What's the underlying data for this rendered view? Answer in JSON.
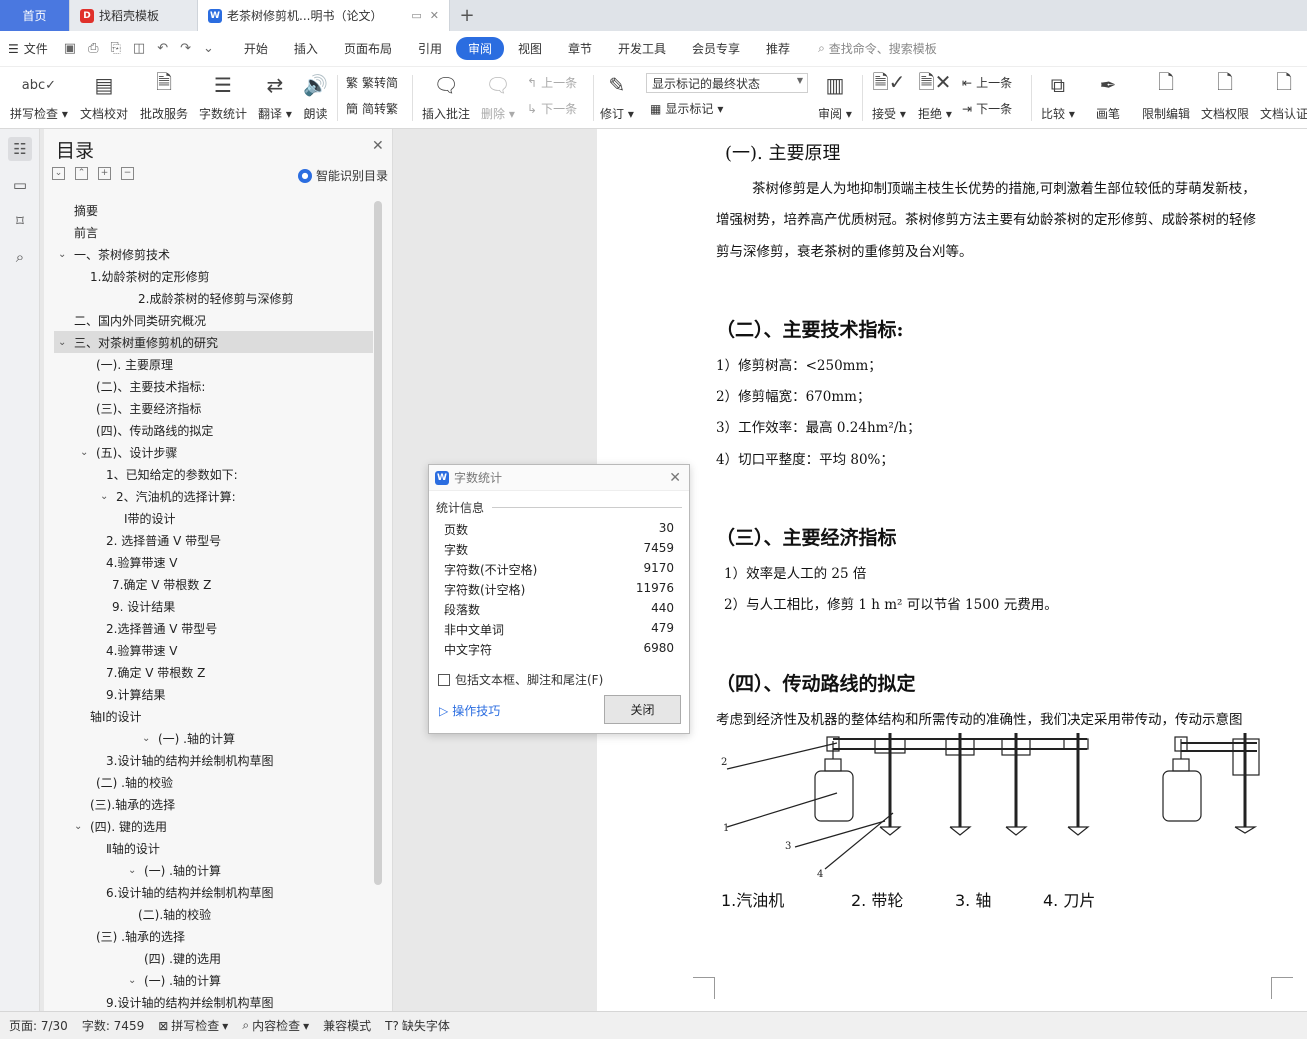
{
  "tabs": [
    {
      "label": "首页"
    },
    {
      "label": "找稻壳模板"
    },
    {
      "label": "老茶树修剪机...明书（论文）"
    }
  ],
  "menu": {
    "file": "文件",
    "items": [
      "开始",
      "插入",
      "页面布局",
      "引用",
      "审阅",
      "视图",
      "章节",
      "开发工具",
      "会员专享",
      "推荐"
    ],
    "active": "审阅",
    "search": "查找命令、搜索模板"
  },
  "ribbon": {
    "spell_check": "拼写检查",
    "doc_proof": "文档校对",
    "proof_service": "批改服务",
    "word_count": "字数统计",
    "translate": "翻译",
    "read_aloud": "朗读",
    "trad_to_simp": "繁转简",
    "simp_to_trad": "简转繁",
    "insert_comment": "插入批注",
    "delete": "删除",
    "prev": "上一条",
    "next": "下一条",
    "revise": "修订",
    "markup_state": "显示标记的最终状态",
    "show_markup": "显示标记",
    "review": "审阅",
    "accept": "接受",
    "reject": "拒绝",
    "prev2": "上一条",
    "next2": "下一条",
    "compare": "比较",
    "pen": "画笔",
    "restrict_edit": "限制编辑",
    "doc_permission": "文档权限",
    "doc_cert": "文档认证"
  },
  "toc": {
    "title": "目录",
    "smart": "智能识别目录",
    "items": [
      {
        "text": "摘要",
        "indent": 20,
        "toggle": ""
      },
      {
        "text": "前言",
        "indent": 20,
        "toggle": ""
      },
      {
        "text": "一、茶树修剪技术",
        "indent": 20,
        "toggle": "v"
      },
      {
        "text": "1.幼龄茶树的定形修剪",
        "indent": 36,
        "toggle": ""
      },
      {
        "text": "2.成龄茶树的轻修剪与深修剪",
        "indent": 84,
        "toggle": ""
      },
      {
        "text": "二、国内外同类研究概况",
        "indent": 20,
        "toggle": ""
      },
      {
        "text": "三、对茶树重修剪机的研究",
        "indent": 20,
        "toggle": "v",
        "selected": true
      },
      {
        "text": "(一). 主要原理",
        "indent": 42,
        "toggle": ""
      },
      {
        "text": "(二)、主要技术指标:",
        "indent": 42,
        "toggle": ""
      },
      {
        "text": "(三)、主要经济指标",
        "indent": 42,
        "toggle": ""
      },
      {
        "text": "(四)、传动路线的拟定",
        "indent": 42,
        "toggle": ""
      },
      {
        "text": "(五)、设计步骤",
        "indent": 42,
        "toggle": "v"
      },
      {
        "text": "1、已知给定的参数如下:",
        "indent": 52,
        "toggle": ""
      },
      {
        "text": "2、汽油机的选择计算:",
        "indent": 62,
        "toggle": "v"
      },
      {
        "text": "Ⅰ带的设计",
        "indent": 70,
        "toggle": ""
      },
      {
        "text": "2. 选择普通 V 带型号",
        "indent": 52,
        "toggle": ""
      },
      {
        "text": "4.验算带速 V",
        "indent": 52,
        "toggle": ""
      },
      {
        "text": "7.确定 V 带根数 Z",
        "indent": 58,
        "toggle": ""
      },
      {
        "text": "9. 设计结果",
        "indent": 58,
        "toggle": ""
      },
      {
        "text": "2.选择普通 V 带型号",
        "indent": 52,
        "toggle": ""
      },
      {
        "text": "4.验算带速 V",
        "indent": 52,
        "toggle": ""
      },
      {
        "text": "7.确定 V 带根数 Z",
        "indent": 52,
        "toggle": ""
      },
      {
        "text": "9.计算结果",
        "indent": 52,
        "toggle": ""
      },
      {
        "text": "轴Ⅰ的设计",
        "indent": 36,
        "toggle": ""
      },
      {
        "text": "(一) .轴的计算",
        "indent": 104,
        "toggle": "v"
      },
      {
        "text": "3.设计轴的结构并绘制机构草图",
        "indent": 52,
        "toggle": ""
      },
      {
        "text": "(二) .轴的校验",
        "indent": 42,
        "toggle": ""
      },
      {
        "text": "(三).轴承的选择",
        "indent": 36,
        "toggle": ""
      },
      {
        "text": "(四). 键的选用",
        "indent": 36,
        "toggle": "v"
      },
      {
        "text": "Ⅱ轴的设计",
        "indent": 52,
        "toggle": ""
      },
      {
        "text": "(一) .轴的计算",
        "indent": 90,
        "toggle": "v"
      },
      {
        "text": "6.设计轴的结构并绘制机构草图",
        "indent": 52,
        "toggle": ""
      },
      {
        "text": "(二).轴的校验",
        "indent": 84,
        "toggle": ""
      },
      {
        "text": "(三) .轴承的选择",
        "indent": 42,
        "toggle": ""
      },
      {
        "text": "(四) .键的选用",
        "indent": 90,
        "toggle": ""
      },
      {
        "text": "(一) .轴的计算",
        "indent": 90,
        "toggle": "v"
      },
      {
        "text": "9.设计轴的结构并绘制机构草图",
        "indent": 52,
        "toggle": ""
      }
    ]
  },
  "document": {
    "h_principle": "(一). 主要原理",
    "p_principle_1": "茶树修剪是人为地抑制顶端主枝生长优势的措施,可刺激着生部位较低的芽萌发新枝，",
    "p_principle_2": "增强树势，培养高产优质树冠。茶树修剪方法主要有幼龄茶树的定形修剪、成龄茶树的轻修",
    "p_principle_3": "剪与深修剪，衰老茶树的重修剪及台刈等。",
    "h_tech": "（二）、主要技术指标:",
    "tech": [
      "1）修剪树高：<250mm；",
      "2）修剪幅宽：670mm；",
      "3）工作效率：最高 0.24hm²/h；",
      "4）切口平整度：平均 80%；"
    ],
    "h_econ": "（三）、主要经济指标",
    "econ": [
      "1）效率是人工的 25 倍",
      "2）与人工相比，修剪 1 h m² 可以节省 1500 元费用。"
    ],
    "h_route": "（四）、传动路线的拟定",
    "p_route": "考虑到经济性及机器的整体结构和所需传动的准确性，我们决定采用带传动，传动示意图",
    "fig_labels": [
      "2",
      "1",
      "3",
      "4"
    ],
    "fig_caption": [
      "1.汽油机",
      "2. 带轮",
      "3. 轴",
      "4. 刀片"
    ]
  },
  "dialog": {
    "title": "字数统计",
    "section": "统计信息",
    "rows": [
      {
        "label": "页数",
        "value": "30"
      },
      {
        "label": "字数",
        "value": "7459"
      },
      {
        "label": "字符数(不计空格)",
        "value": "9170"
      },
      {
        "label": "字符数(计空格)",
        "value": "11976"
      },
      {
        "label": "段落数",
        "value": "440"
      },
      {
        "label": "非中文单词",
        "value": "479"
      },
      {
        "label": "中文字符",
        "value": "6980"
      }
    ],
    "checkbox": "包括文本框、脚注和尾注(F)",
    "tips": "操作技巧",
    "close": "关闭"
  },
  "status": {
    "page": "页面: 7/30",
    "words": "字数: 7459",
    "spell": "拼写检查",
    "content": "内容检查",
    "compat": "兼容模式",
    "missing_font": "缺失字体"
  },
  "colors": {
    "accent": "#2b6de0",
    "home_tab": "#4a78e0",
    "wps_red": "#e0312b"
  }
}
